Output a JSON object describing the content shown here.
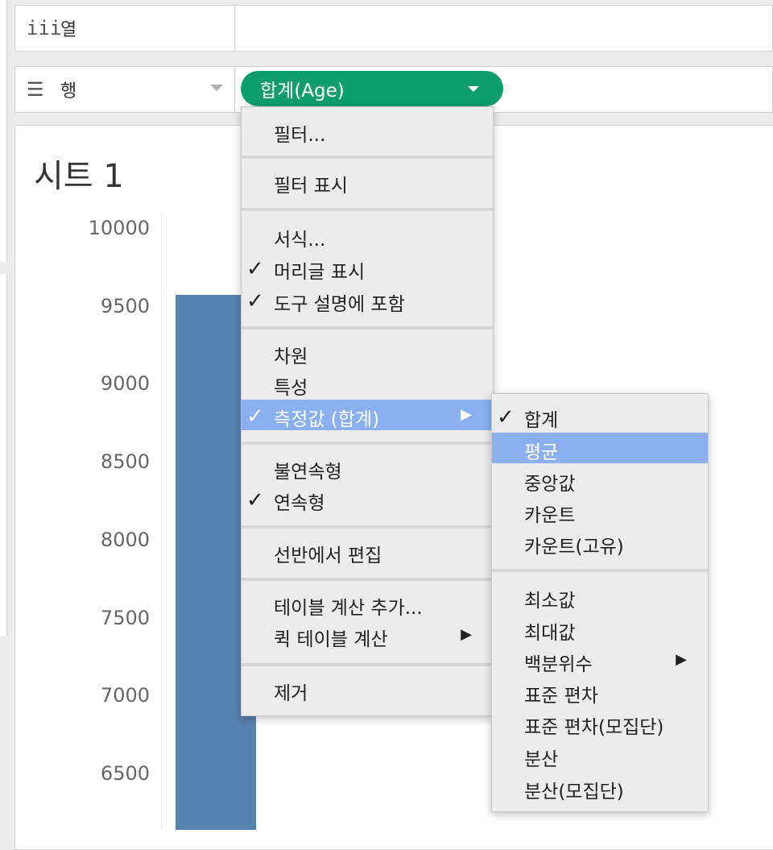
{
  "shelves": {
    "columns": {
      "icon": "columns-icon",
      "label": "열"
    },
    "rows": {
      "icon": "rows-icon",
      "label": "행"
    }
  },
  "pill": {
    "label": "합계(Age)",
    "color": "#0f9d6e"
  },
  "sheet": {
    "title": "시트 1",
    "y_ticks": [
      "10000",
      "9500",
      "9000",
      "8500",
      "8000",
      "7500",
      "7000",
      "6500"
    ]
  },
  "chart_data": {
    "type": "bar",
    "title": "",
    "y_ticks": [
      10000,
      9500,
      9000,
      8500,
      8000,
      7500,
      7000,
      6500
    ],
    "series": [
      {
        "values": [
          9570
        ]
      }
    ],
    "bar_color": "#5882b0"
  },
  "context_menu": {
    "items": [
      {
        "label": "필터...",
        "checked": false,
        "submenu": false
      },
      {
        "label": "필터 표시",
        "checked": false,
        "submenu": false
      },
      {
        "label": "서식...",
        "checked": false,
        "submenu": false
      },
      {
        "label": "머리글 표시",
        "checked": true,
        "submenu": false
      },
      {
        "label": "도구 설명에 포함",
        "checked": true,
        "submenu": false
      },
      {
        "label": "차원",
        "checked": false,
        "submenu": false
      },
      {
        "label": "특성",
        "checked": false,
        "submenu": false
      },
      {
        "label": "측정값 (합계)",
        "checked": true,
        "submenu": true,
        "highlighted": true
      },
      {
        "label": "불연속형",
        "checked": false,
        "submenu": false
      },
      {
        "label": "연속형",
        "checked": true,
        "submenu": false
      },
      {
        "label": "선반에서 편집",
        "checked": false,
        "submenu": false
      },
      {
        "label": "테이블 계산 추가...",
        "checked": false,
        "submenu": false
      },
      {
        "label": "퀵 테이블 계산",
        "checked": false,
        "submenu": true
      },
      {
        "label": "제거",
        "checked": false,
        "submenu": false
      }
    ],
    "check_glyph": "✓",
    "arrow_glyph": "▶"
  },
  "submenu": {
    "items": [
      {
        "label": "합계",
        "checked": true
      },
      {
        "label": "평균",
        "highlighted": true
      },
      {
        "label": "중앙값"
      },
      {
        "label": "카운트"
      },
      {
        "label": "카운트(고유)"
      },
      {
        "label": "최소값"
      },
      {
        "label": "최대값"
      },
      {
        "label": "백분위수",
        "submenu": true
      },
      {
        "label": "표준 편차"
      },
      {
        "label": "표준 편차(모집단)"
      },
      {
        "label": "분산"
      },
      {
        "label": "분산(모집단)"
      }
    ],
    "highlight_color": "#8ab0ef"
  }
}
